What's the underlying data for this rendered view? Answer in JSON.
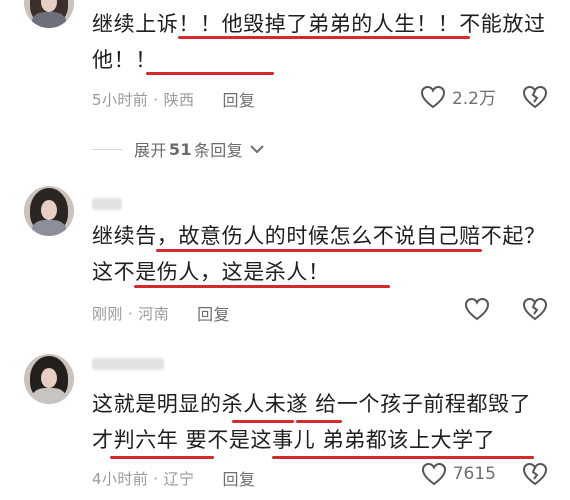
{
  "comments": [
    {
      "text": "继续上诉！！他毁掉了弟弟的人生！！不能放过他！！",
      "location_time": "5小时前 · 陕西",
      "reply_label": "回复",
      "likes": "2.2万"
    },
    {
      "text": "继续告，故意伤人的时候怎么不说自己赔不起？这不是伤人，这是杀人！",
      "location_time": "刚刚 · 河南",
      "reply_label": "回复",
      "likes": ""
    },
    {
      "text": "这就是明显的杀人未遂 给一个孩子前程都毁了才判六年 要不是这事儿 弟弟都该上大学了",
      "location_time": "4小时前 · 辽宁",
      "reply_label": "回复",
      "likes": "7615"
    }
  ],
  "expand": {
    "prefix": "展开",
    "count": "51",
    "suffix": "条回复"
  },
  "colors": {
    "underline": "#d62a2a",
    "meta": "#9a9a9a"
  },
  "icons": [
    "heart-icon",
    "broken-heart-icon",
    "chevron-down-icon"
  ]
}
